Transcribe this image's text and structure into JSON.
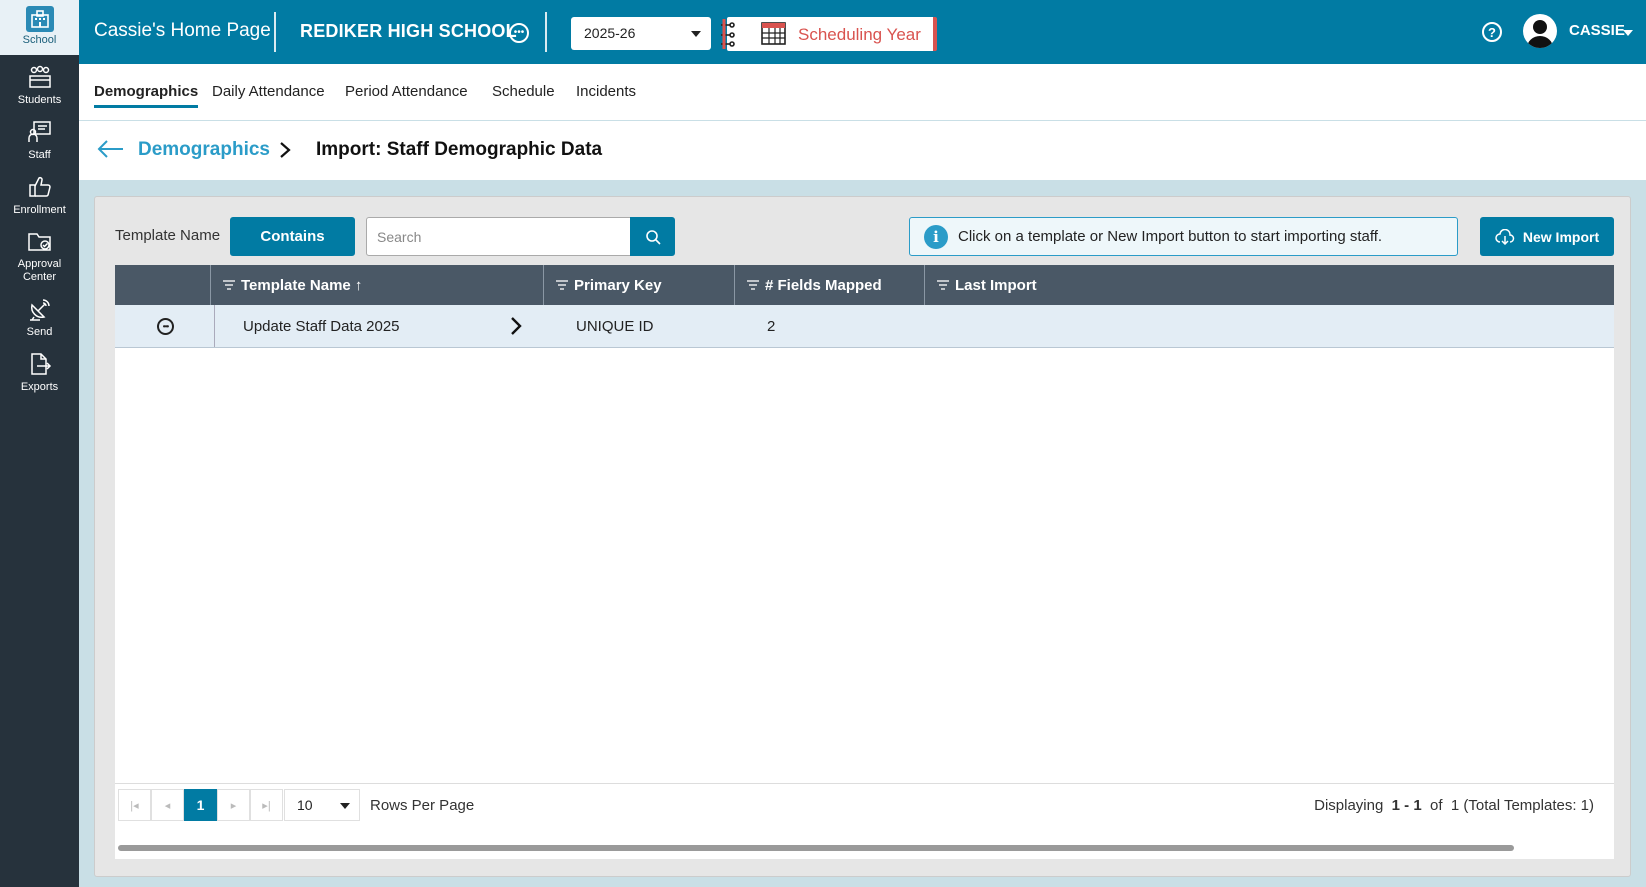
{
  "sidebar": {
    "items": [
      {
        "label": "School",
        "icon": "school-building-icon"
      },
      {
        "label": "Students",
        "icon": "students-icon"
      },
      {
        "label": "Staff",
        "icon": "staff-icon"
      },
      {
        "label": "Enrollment",
        "icon": "thumbs-up-icon"
      },
      {
        "label": "Approval Center",
        "icon": "folder-check-icon"
      },
      {
        "label": "Send",
        "icon": "satellite-dish-icon"
      },
      {
        "label": "Exports",
        "icon": "file-export-icon"
      }
    ]
  },
  "topbar": {
    "home_title": "Cassie's Home Page",
    "school_name": "REDIKER HIGH SCHOOL",
    "year": "2025-26",
    "scheduling_label": "Scheduling Year",
    "user_name": "CASSIE",
    "help_glyph": "?"
  },
  "tabs": [
    {
      "label": "Demographics",
      "active": true
    },
    {
      "label": "Daily Attendance"
    },
    {
      "label": "Period Attendance"
    },
    {
      "label": "Schedule"
    },
    {
      "label": "Incidents"
    }
  ],
  "breadcrumb": {
    "parent": "Demographics",
    "current": "Import: Staff Demographic Data"
  },
  "filter": {
    "label": "Template Name",
    "operator": "Contains",
    "search_placeholder": "Search"
  },
  "info_message": "Click on a template or New Import button to start importing staff.",
  "new_import_label": "New Import",
  "grid": {
    "columns": [
      "Template Name ↑",
      "Primary Key",
      "# Fields Mapped",
      "Last Import"
    ],
    "rows": [
      {
        "template_name": "Update Staff Data 2025",
        "primary_key": "UNIQUE ID",
        "fields_mapped": "2",
        "last_import": ""
      }
    ]
  },
  "pager": {
    "current_page": "1",
    "rows_per_page": "10",
    "rows_per_page_label": "Rows Per Page",
    "display_prefix": "Displaying",
    "display_range": "1 - 1",
    "display_of": "of",
    "display_total": "1 (Total Templates: 1)"
  },
  "colors": {
    "brand": "#017ba3",
    "sidebar": "#26323c",
    "scheduling_accent": "#d9534f",
    "link": "#2b9cc8"
  }
}
